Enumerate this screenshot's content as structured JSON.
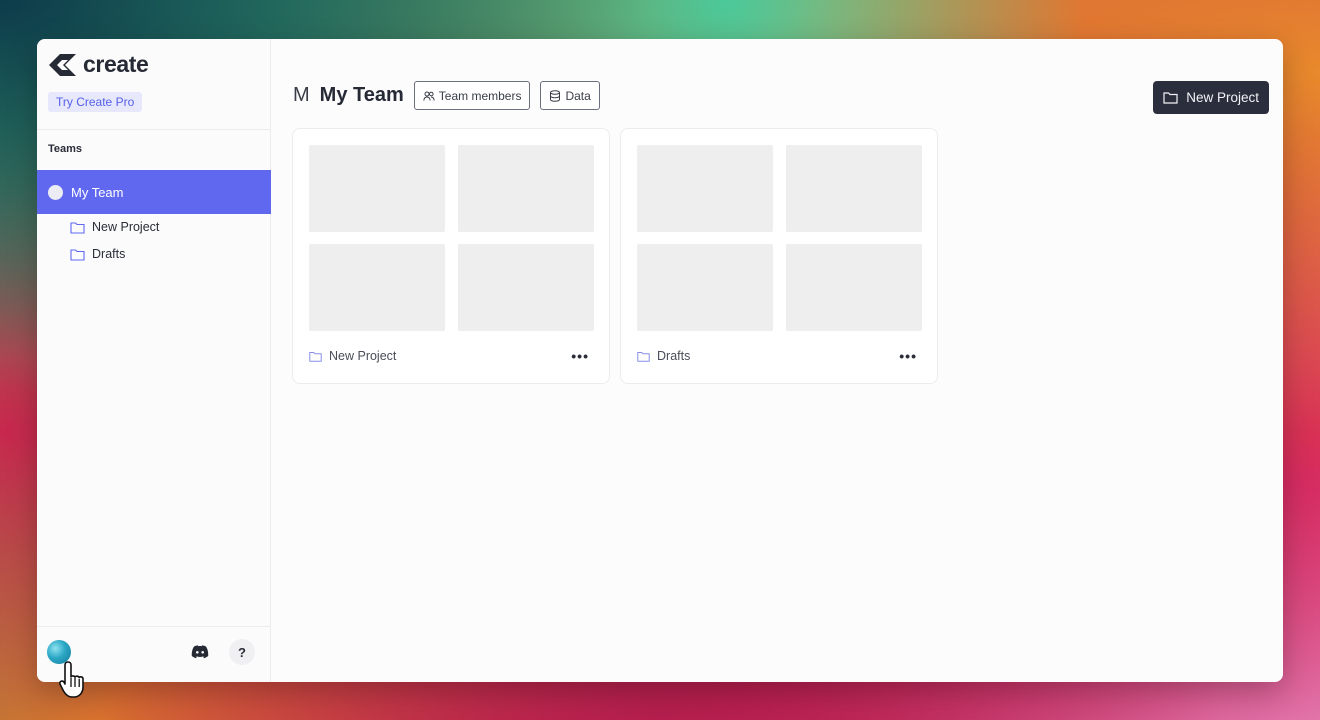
{
  "app": {
    "name": "create"
  },
  "sidebar": {
    "try_pro_label": "Try Create Pro",
    "teams_label": "Teams",
    "team": {
      "name": "My Team"
    },
    "folders": [
      {
        "label": "New Project"
      },
      {
        "label": "Drafts"
      }
    ],
    "help_label": "?"
  },
  "header": {
    "team_initial": "M",
    "title": "My Team",
    "team_members_label": "Team members",
    "data_label": "Data",
    "new_project_label": "New Project"
  },
  "projects": [
    {
      "name": "New Project",
      "menu": "•••"
    },
    {
      "name": "Drafts",
      "menu": "•••"
    }
  ],
  "colors": {
    "accent": "#6068f0",
    "dark_button": "#2b2e3d",
    "pro_badge_bg": "#e7e8fb",
    "pro_badge_text": "#5560e8"
  },
  "icons": [
    "create-logo-icon",
    "folder-icon",
    "team-members-icon",
    "database-icon",
    "discord-icon",
    "help-icon",
    "more-icon",
    "hand-cursor-icon"
  ]
}
